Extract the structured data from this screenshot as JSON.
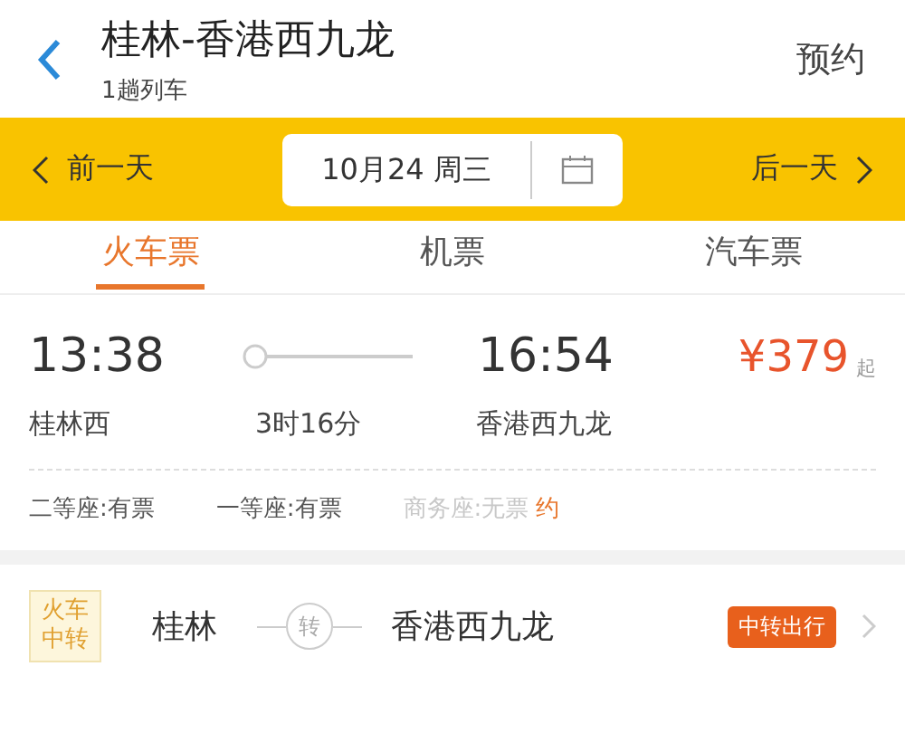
{
  "header": {
    "title": "桂林-香港西九龙",
    "subtitle": "1趟列车",
    "action": "预约"
  },
  "date_bar": {
    "prev": "前一天",
    "date": "10月24 周三",
    "next": "后一天"
  },
  "tabs": [
    {
      "label": "火车票",
      "selected": true
    },
    {
      "label": "机票",
      "selected": false
    },
    {
      "label": "汽车票",
      "selected": false
    }
  ],
  "train": {
    "depart_time": "13:38",
    "arrive_time": "16:54",
    "price": "¥379",
    "price_suffix": "起",
    "depart_station": "桂林西",
    "duration": "3时16分",
    "arrive_station": "香港西九龙",
    "seats": [
      {
        "label": "二等座:有票",
        "available": true
      },
      {
        "label": "一等座:有票",
        "available": true
      },
      {
        "label": "商务座:无票",
        "available": false,
        "reserve": "约"
      }
    ]
  },
  "transfer": {
    "badge": "火车中转",
    "from": "桂林",
    "via": "转",
    "to": "香港西九龙",
    "tag": "中转出行"
  }
}
